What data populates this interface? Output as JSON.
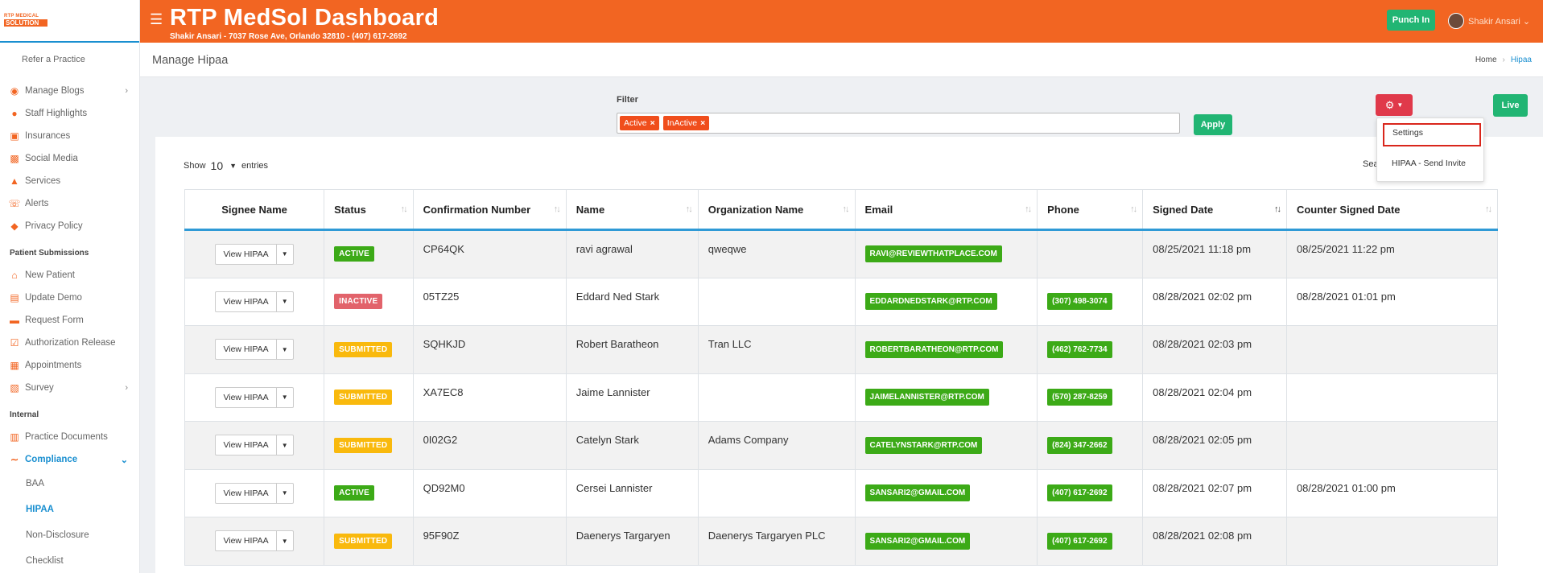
{
  "sidebar": {
    "logo_line1": "RTP MEDICAL",
    "logo_line2": "SOLUTION",
    "refer": "Refer a Practice",
    "items_top": [
      {
        "label": "Manage Blogs",
        "icon": "rss-icon",
        "has_chevron": true
      },
      {
        "label": "Staff Highlights",
        "icon": "user-icon",
        "has_chevron": false
      },
      {
        "label": "Insurances",
        "icon": "briefcase-icon",
        "has_chevron": false
      },
      {
        "label": "Social Media",
        "icon": "social-icon",
        "has_chevron": false
      },
      {
        "label": "Services",
        "icon": "services-icon",
        "has_chevron": false
      },
      {
        "label": "Alerts",
        "icon": "phone-icon",
        "has_chevron": false
      },
      {
        "label": "Privacy Policy",
        "icon": "shield-icon",
        "has_chevron": false
      }
    ],
    "section_patient": "Patient Submissions",
    "items_patient": [
      {
        "label": "New Patient",
        "icon": "home-icon",
        "has_chevron": false
      },
      {
        "label": "Update Demo",
        "icon": "id-card-icon",
        "has_chevron": false
      },
      {
        "label": "Request Form",
        "icon": "form-icon",
        "has_chevron": false
      },
      {
        "label": "Authorization Release",
        "icon": "file-check-icon",
        "has_chevron": false
      },
      {
        "label": "Appointments",
        "icon": "calendar-icon",
        "has_chevron": false
      },
      {
        "label": "Survey",
        "icon": "chart-icon",
        "has_chevron": true
      }
    ],
    "section_internal": "Internal",
    "items_internal": [
      {
        "label": "Practice Documents",
        "icon": "clipboard-icon",
        "has_chevron": false
      },
      {
        "label": "Compliance",
        "icon": "wave-icon",
        "has_chevron": true
      }
    ],
    "sub_items": [
      "BAA",
      "HIPAA",
      "Non-Disclosure",
      "Checklist"
    ]
  },
  "header": {
    "title": "RTP MedSol Dashboard",
    "subtitle": "Shakir Ansari - 7037 Rose Ave, Orlando 32810 - (407) 617-2692",
    "punch_in": "Punch In",
    "user_name": "Shakir Ansari",
    "accent": "#f26522"
  },
  "subheader": {
    "page_title": "Manage Hipaa",
    "breadcrumb_home": "Home",
    "breadcrumb_current": "Hipaa"
  },
  "filter": {
    "label": "Filter",
    "chips": [
      "Active",
      "InActive"
    ],
    "apply": "Apply"
  },
  "live": "Live",
  "dropdown": {
    "settings": "Settings",
    "send_invite": "HIPAA - Send Invite"
  },
  "table_controls": {
    "show": "Show",
    "entries_value": "10",
    "entries": "entries",
    "search": "Sea"
  },
  "table": {
    "columns": [
      "Signee Name",
      "Status",
      "Confirmation Number",
      "Name",
      "Organization Name",
      "Email",
      "Phone",
      "Signed Date",
      "Counter Signed Date"
    ],
    "view_label": "View HIPAA",
    "rows": [
      {
        "status": "ACTIVE",
        "status_class": "b-active",
        "conf": "CP64QK",
        "name": "ravi agrawal",
        "org": "qweqwe",
        "email": "RAVI@REVIEWTHATPLACE.COM",
        "phone": "",
        "signed": "08/25/2021 11:18 pm",
        "counter": "08/25/2021 11:22 pm"
      },
      {
        "status": "INACTIVE",
        "status_class": "b-inactive",
        "conf": "05TZ25",
        "name": "Eddard Ned Stark",
        "org": "",
        "email": "EDDARDNEDSTARK@RTP.COM",
        "phone": "(307) 498-3074",
        "signed": "08/28/2021 02:02 pm",
        "counter": "08/28/2021 01:01 pm"
      },
      {
        "status": "SUBMITTED",
        "status_class": "b-submitted",
        "conf": "SQHKJD",
        "name": "Robert Baratheon",
        "org": "Tran LLC",
        "email": "ROBERTBARATHEON@RTP.COM",
        "phone": "(462) 762-7734",
        "signed": "08/28/2021 02:03 pm",
        "counter": ""
      },
      {
        "status": "SUBMITTED",
        "status_class": "b-submitted",
        "conf": "XA7EC8",
        "name": "Jaime Lannister",
        "org": "",
        "email": "JAIMELANNISTER@RTP.COM",
        "phone": "(570) 287-8259",
        "signed": "08/28/2021 02:04 pm",
        "counter": ""
      },
      {
        "status": "SUBMITTED",
        "status_class": "b-submitted",
        "conf": "0I02G2",
        "name": "Catelyn Stark",
        "org": "Adams Company",
        "email": "CATELYNSTARK@RTP.COM",
        "phone": "(824) 347-2662",
        "signed": "08/28/2021 02:05 pm",
        "counter": ""
      },
      {
        "status": "ACTIVE",
        "status_class": "b-active",
        "conf": "QD92M0",
        "name": "Cersei Lannister",
        "org": "",
        "email": "SANSARI2@GMAIL.COM",
        "phone": "(407) 617-2692",
        "signed": "08/28/2021 02:07 pm",
        "counter": "08/28/2021 01:00 pm"
      },
      {
        "status": "SUBMITTED",
        "status_class": "b-submitted",
        "conf": "95F90Z",
        "name": "Daenerys Targaryen",
        "org": "Daenerys Targaryen PLC",
        "email": "SANSARI2@GMAIL.COM",
        "phone": "(407) 617-2692",
        "signed": "08/28/2021 02:08 pm",
        "counter": ""
      }
    ]
  }
}
